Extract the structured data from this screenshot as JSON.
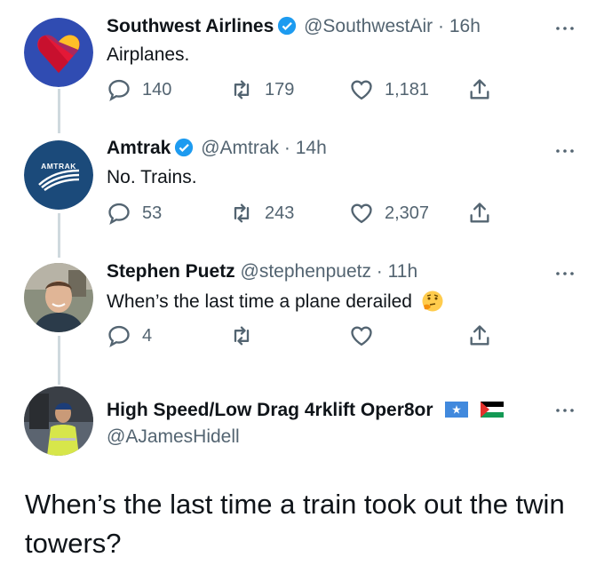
{
  "tweets": [
    {
      "name": "Southwest Airlines",
      "handle": "@SouthwestAir",
      "time": "16h",
      "text": "Airplanes.",
      "replies": "140",
      "retweets": "179",
      "likes": "1,181"
    },
    {
      "name": "Amtrak",
      "handle": "@Amtrak",
      "time": "14h",
      "text": "No. Trains.",
      "replies": "53",
      "retweets": "243",
      "likes": "2,307",
      "avatar_text": "AMTRAK"
    },
    {
      "name": "Stephen Puetz",
      "handle": "@stephenpuetz",
      "time": "11h",
      "text": "When’s the last time a plane derailed",
      "replies": "4"
    }
  ],
  "main_tweet": {
    "name": "High Speed/Low Drag 4rklift Oper8or",
    "handle": "@AJamesHidell",
    "text": "When’s the last time a train took out the twin towers?"
  },
  "separator": "·",
  "colors": {
    "verified_blue": "#1d9bf0",
    "secondary_text": "#536471",
    "southwest_blue": "#304cb2",
    "amtrak_blue": "#1b4a7a"
  }
}
